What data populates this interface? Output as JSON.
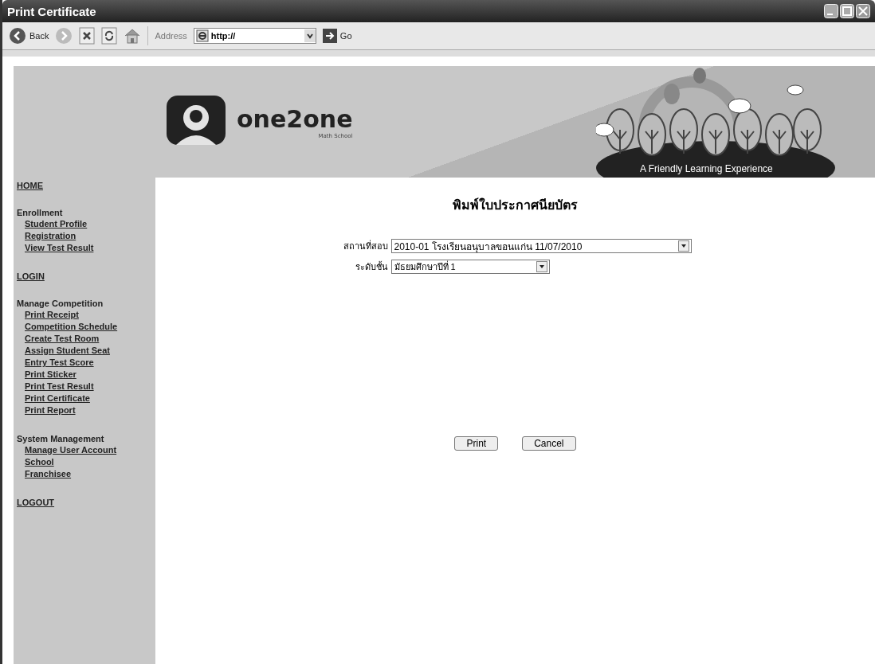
{
  "window": {
    "title": "Print Certificate"
  },
  "toolbar": {
    "back": "Back",
    "address_label": "Address",
    "address": "http://",
    "go": "Go"
  },
  "banner": {
    "brand": "one2one",
    "subtitle": "Math School",
    "tagline": "A Friendly Learning Experience"
  },
  "sidebar": {
    "sections": [
      {
        "kind": "link",
        "label": "HOME"
      },
      {
        "kind": "group",
        "label": "Enrollment",
        "children": [
          "Student Profile",
          "Registration",
          "View Test Result"
        ]
      },
      {
        "kind": "link",
        "label": "LOGIN"
      },
      {
        "kind": "group",
        "label": "Manage Competition",
        "children": [
          "Print Receipt",
          "Competition Schedule",
          "Create Test Room",
          "Assign Student Seat",
          "Entry Test Score",
          "Print Sticker",
          "Print Test Result",
          "Print Certificate",
          "Print Report"
        ]
      },
      {
        "kind": "group",
        "label": "System Management",
        "children": [
          "Manage User Account",
          "School",
          "Franchisee"
        ]
      },
      {
        "kind": "link",
        "label": "LOGOUT"
      }
    ]
  },
  "form": {
    "heading": "พิมพ์ใบประกาศนียบัตร",
    "fields": [
      {
        "label": "สถานที่สอบ",
        "value": "2010-01 โรงเรียนอนุบาลขอนแก่น 11/07/2010",
        "kind": "wide"
      },
      {
        "label": "ระดับชั้น",
        "value": "มัธยมศึกษาปีที่ 1",
        "kind": "narrow"
      }
    ],
    "buttons": [
      "Print",
      "Cancel"
    ]
  }
}
